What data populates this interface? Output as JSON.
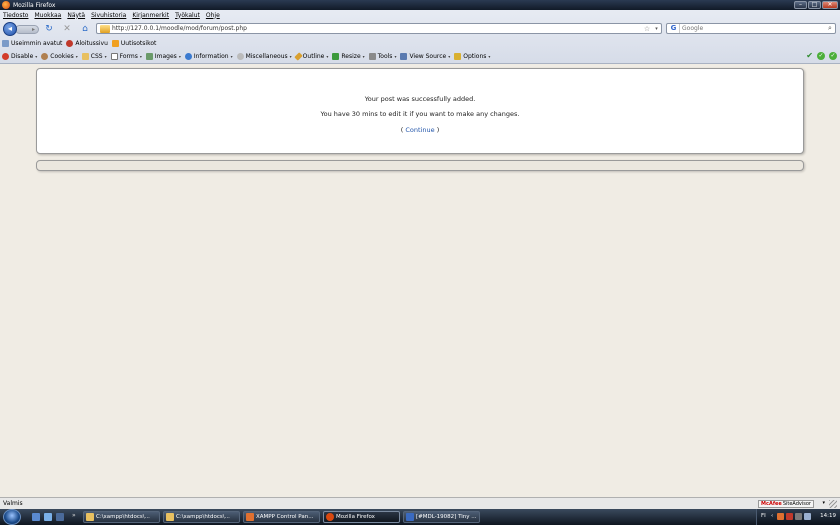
{
  "window": {
    "title": "Mozilla Firefox"
  },
  "menu": [
    "Tiedosto",
    "Muokkaa",
    "Näytä",
    "Sivuhistoria",
    "Kirjanmerkit",
    "Työkalut",
    "Ohje"
  ],
  "nav": {
    "url": "http://127.0.0.1/moodle/mod/forum/post.php",
    "search_placeholder": "Google"
  },
  "bookmarks": [
    "Useimmin avatut",
    "Aloitussivu",
    "Uutisotsikot"
  ],
  "devtoolbar": [
    "Disable",
    "Cookies",
    "CSS",
    "Forms",
    "Images",
    "Information",
    "Miscellaneous",
    "Outline",
    "Resize",
    "Tools",
    "View Source",
    "Options"
  ],
  "message": {
    "line1": "Your post was successfully added.",
    "line2": "You have 30 mins to edit it if you want to make any changes.",
    "continue_label": "Continue",
    "open_paren": "(",
    "close_paren": ")"
  },
  "status": {
    "text": "Valmis",
    "mcafee": "McAfee",
    "siteadvisor": "SiteAdvisor"
  },
  "taskbar": {
    "tasks": [
      "C:\\xampp\\htdocs\\...",
      "C:\\xampp\\htdocs\\...",
      "XAMPP Control Pan...",
      "Mozilla Firefox",
      "[#MDL-19082] Tiny ..."
    ],
    "lang": "FI",
    "clock": "14:19"
  }
}
